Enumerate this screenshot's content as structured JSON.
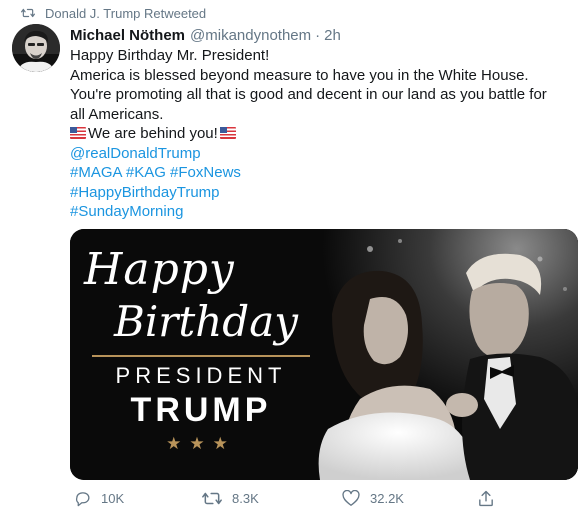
{
  "retweet_context": {
    "label": "Donald J. Trump Retweeted",
    "icon": "retweet-icon"
  },
  "tweet": {
    "author_name": "Michael Nöthem",
    "author_handle": "@mikandynothem",
    "separator": "·",
    "time": "2h",
    "lines": [
      "Happy Birthday Mr. President!",
      "America is blessed beyond measure to have you in the White House.",
      "You're promoting all that is good and decent in our land as you battle for",
      "all Americans."
    ],
    "flag_line": "We are behind you!",
    "flag_icon": "us-flag-icon",
    "hashtag_lines": [
      "@realDonaldTrump",
      "#MAGA #KAG #FoxNews",
      "#HappyBirthdayTrump",
      "#SundayMorning"
    ]
  },
  "media": {
    "happy": "Happy",
    "birthday": "Birthday",
    "president": "PRESIDENT",
    "trump": "TRUMP",
    "stars": "★★★"
  },
  "actions": {
    "replies": "10K",
    "retweets": "8.3K",
    "likes": "32.2K"
  },
  "colors": {
    "link": "#1b95e0",
    "muted": "#657786",
    "text": "#14171a",
    "gold": "#b8935a"
  }
}
